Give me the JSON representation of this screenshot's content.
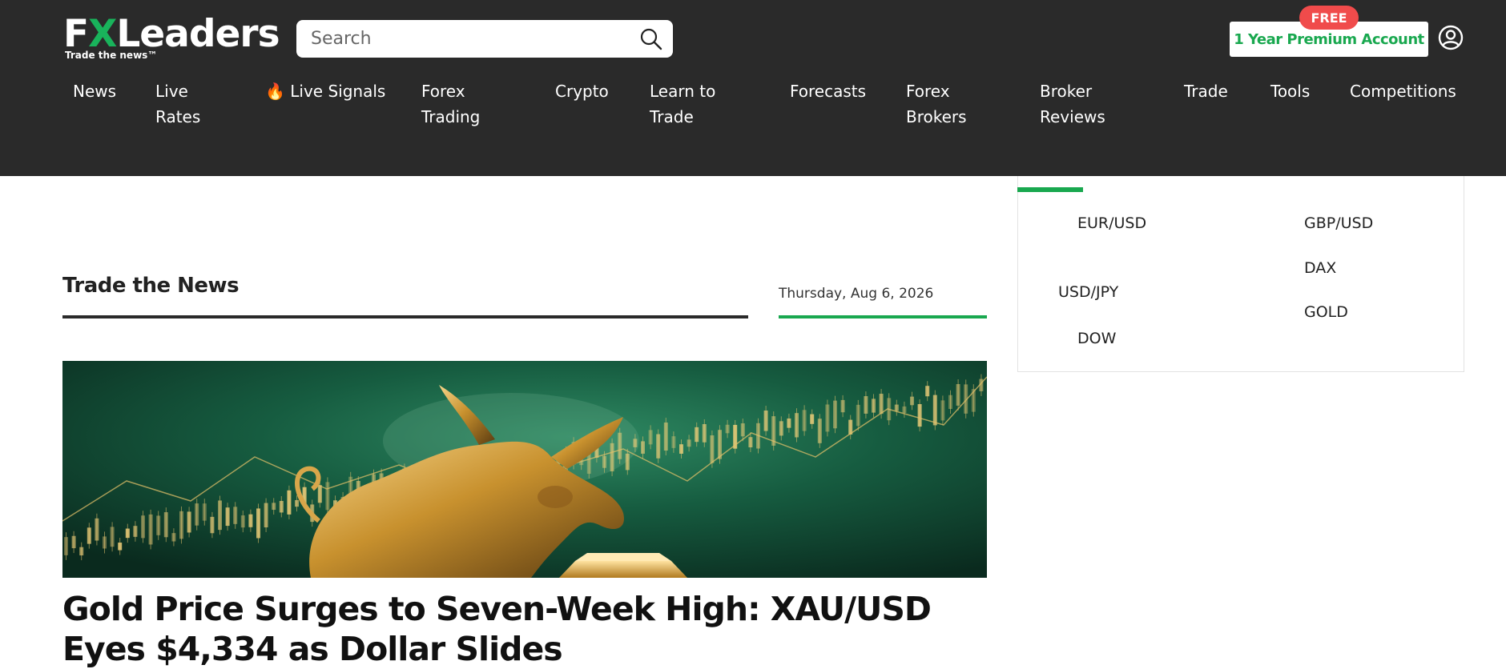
{
  "header": {
    "logo": {
      "text_left": "F",
      "text_x": "X",
      "text_rest": "Leaders",
      "tagline": "Trade the news™"
    },
    "search": {
      "placeholder": "Search",
      "icon": "search-icon"
    },
    "premium": {
      "label": "1 Year Premium Account",
      "badge": "FREE"
    },
    "user_icon": "user-icon"
  },
  "nav": {
    "items": [
      {
        "label": "News"
      },
      {
        "label": "Live\nRates"
      },
      {
        "label": "Live Signals",
        "icon": "fire-icon",
        "icon_glyph": "🔥"
      },
      {
        "label": "Forex\nTrading"
      },
      {
        "label": "Crypto"
      },
      {
        "label": "Learn to\nTrade"
      },
      {
        "label": "Forecasts"
      },
      {
        "label": "Forex\nBrokers"
      },
      {
        "label": "Broker\nReviews"
      },
      {
        "label": "Trade"
      },
      {
        "label": "Tools"
      },
      {
        "label": "Competitions"
      }
    ]
  },
  "main": {
    "section_title": "Trade the News",
    "date": "Thursday, Aug 6, 2026",
    "hero_alt": "bull-gold-chart-image",
    "headline": "Gold Price Surges to Seven-Week High: XAU/USD Eyes $4,334 as Dollar Slides"
  },
  "sidebar": {
    "pairs": [
      "EUR/USD",
      "GBP/USD",
      "DAX",
      "USD/JPY",
      "GOLD",
      "DOW"
    ]
  },
  "colors": {
    "header_bg": "#2a2a2a",
    "accent_green": "#19a84f",
    "badge_red": "#f04b4b"
  }
}
